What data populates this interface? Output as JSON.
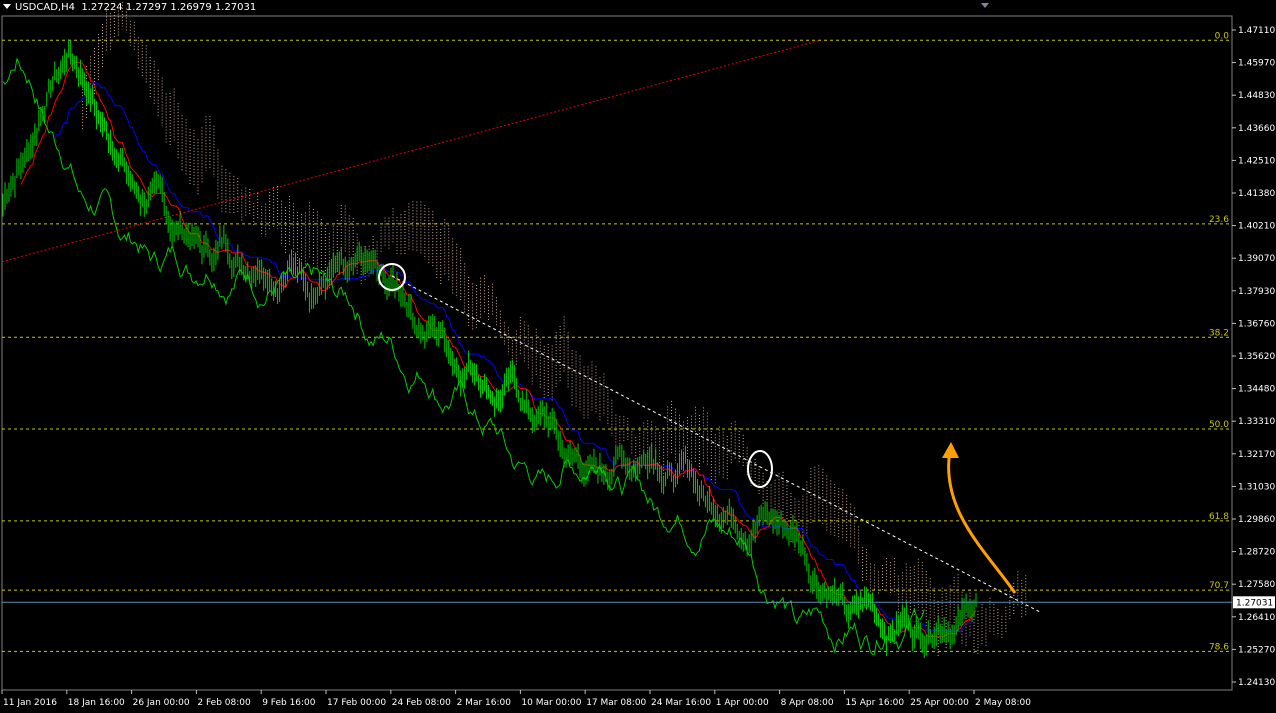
{
  "header": {
    "symbol": "USDCAD,H4",
    "ohlc": "1.27224 1.27297 1.26979 1.27031"
  },
  "colors": {
    "background": "#000000",
    "price": "#00cc00",
    "tenkan": "#ff0000",
    "kijun": "#0000ff",
    "cloud": "#f4c7b0",
    "fib": "#c8c800",
    "trend": "#ffffff",
    "fib_ray": "#e00000",
    "arrow": "#ffa000",
    "marker": "#ffffff",
    "current_line": "#5a8fb4"
  },
  "chart_data": {
    "type": "line",
    "title": "USDCAD,H4",
    "y_axis_labels": [
      "1.47110",
      "1.45970",
      "1.44830",
      "1.43660",
      "1.42510",
      "1.41380",
      "1.40210",
      "1.39070",
      "1.37930",
      "1.36760",
      "1.35620",
      "1.34480",
      "1.33310",
      "1.32170",
      "1.31030",
      "1.29860",
      "1.28720",
      "1.27580",
      "1.26410",
      "1.25270",
      "1.24130"
    ],
    "x_axis_labels": [
      "11 Jan 2016",
      "18 Jan 16:00",
      "26 Jan 00:00",
      "2 Feb 08:00",
      "9 Feb 16:00",
      "17 Feb 00:00",
      "24 Feb 08:00",
      "2 Mar 16:00",
      "10 Mar 00:00",
      "17 Mar 08:00",
      "24 Mar 16:00",
      "1 Apr 00:00",
      "8 Apr 08:00",
      "15 Apr 16:00",
      "25 Apr 00:00",
      "2 May 08:00"
    ],
    "ylim": [
      1.24,
      1.478
    ],
    "current_price": "1.27031",
    "fib_levels": [
      {
        "label": "0.0",
        "price": 1.4675
      },
      {
        "label": "23.6",
        "price": 1.4031
      },
      {
        "label": "38.2",
        "price": 1.3633
      },
      {
        "label": "50.0",
        "price": 1.3311
      },
      {
        "label": "61.8",
        "price": 1.2989
      },
      {
        "label": "70.7",
        "price": 1.2746
      },
      {
        "label": "78.6",
        "price": 1.2531
      }
    ],
    "series": [
      {
        "x": [
          "11 Jan 2016",
          "18 Jan 16:00",
          "26 Jan 00:00",
          "2 Feb 08:00",
          "9 Feb 16:00",
          "17 Feb 00:00",
          "24 Feb 08:00",
          "2 Mar 16:00",
          "10 Mar 00:00",
          "17 Mar 08:00",
          "24 Mar 16:00",
          "1 Apr 00:00",
          "8 Apr 08:00",
          "15 Apr 16:00",
          "25 Apr 00:00",
          "2 May 08:00"
        ],
        "values": [
          1.41,
          1.466,
          1.418,
          1.395,
          1.392,
          1.385,
          1.38,
          1.358,
          1.342,
          1.315,
          1.325,
          1.305,
          1.3,
          1.268,
          1.262,
          1.27
        ]
      }
    ]
  }
}
